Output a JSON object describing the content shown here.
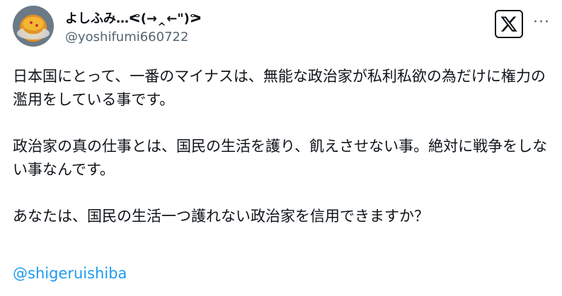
{
  "author": {
    "display_name": "よしふみ…ᕙ(→‸←\")ᕗ",
    "handle": "@yoshifumi660722",
    "avatar_icon": "avatar-pancake-photo"
  },
  "header_actions": {
    "logo_icon": "x-logo-icon",
    "more_icon": "more-dots-icon",
    "more_glyph": "···"
  },
  "tweet": {
    "paragraphs": [
      "日本国にとって、一番のマイナスは、無能な政治家が私利私欲の為だけに権力の濫用をしている事です。",
      "政治家の真の仕事とは、国民の生活を護り、飢えさせない事。絶対に戦争をしない事なんです。",
      "あなたは、国民の生活一つ護れない政治家を信用できますか？"
    ],
    "mention": "@shigeruishiba"
  },
  "colors": {
    "text": "#0f1419",
    "secondary": "#536471",
    "link": "#1d9bf0"
  }
}
